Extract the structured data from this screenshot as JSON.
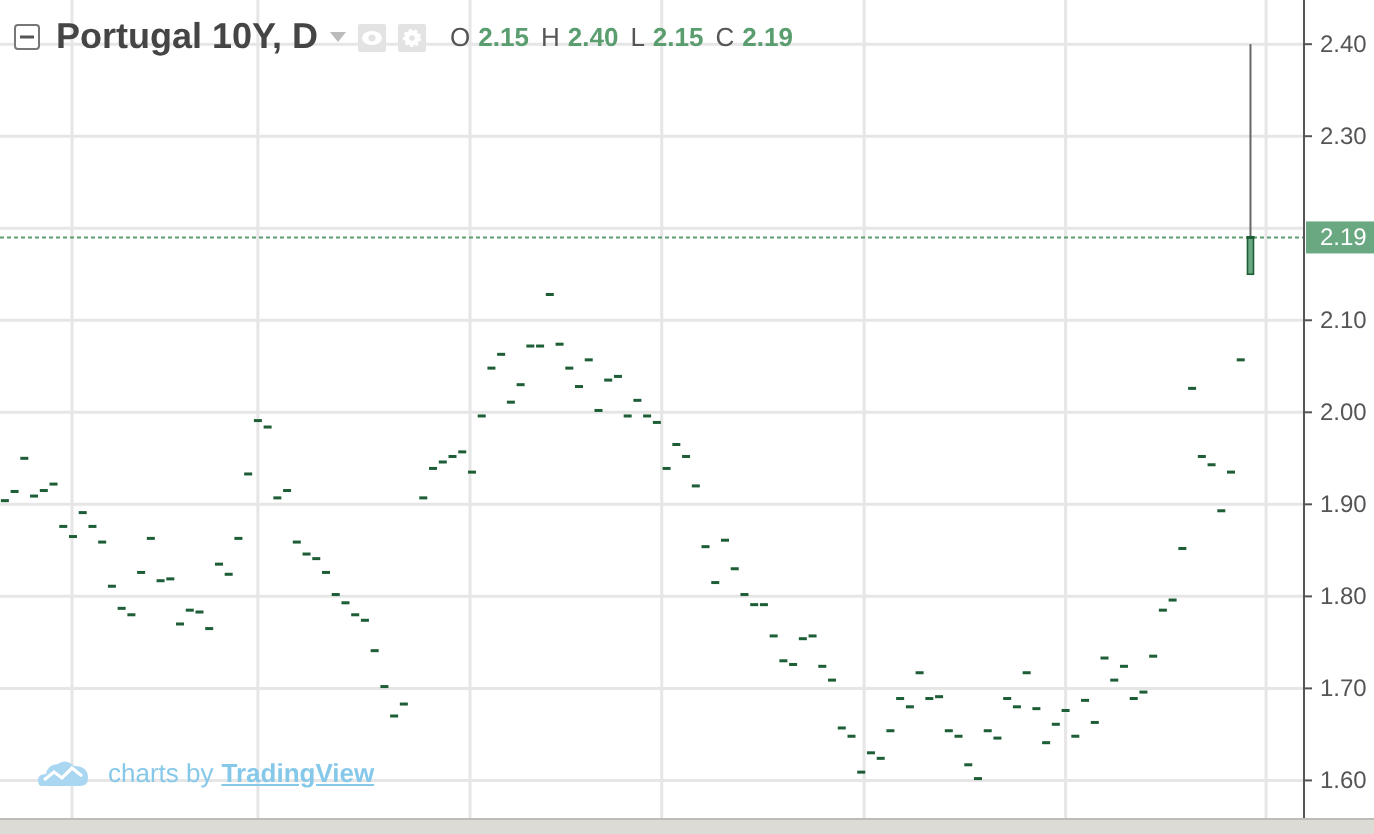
{
  "header": {
    "title": "Portugal 10Y, D",
    "ohlc": [
      {
        "label": "O",
        "value": "2.15"
      },
      {
        "label": "H",
        "value": "2.40"
      },
      {
        "label": "L",
        "value": "2.15"
      },
      {
        "label": "C",
        "value": "2.19"
      }
    ]
  },
  "chart": {
    "chart_data": {
      "type": "scatter",
      "grid": true,
      "ylim": [
        1.557,
        2.448
      ],
      "yticks": [
        {
          "value": 1.6,
          "label": "1.60"
        },
        {
          "value": 1.7,
          "label": "1.70"
        },
        {
          "value": 1.8,
          "label": "1.80"
        },
        {
          "value": 1.9,
          "label": "1.90"
        },
        {
          "value": 2.0,
          "label": "2.00"
        },
        {
          "value": 2.1,
          "label": "2.10"
        },
        {
          "value": 2.3,
          "label": "2.30"
        },
        {
          "value": 2.4,
          "label": "2.40"
        }
      ],
      "ref_lines": [
        {
          "axis": "y",
          "value": 2.19,
          "label": "2.19",
          "color": "#5a9e6f"
        }
      ],
      "series": [
        {
          "color": "#1d5e36",
          "values": [
            1.904,
            1.914,
            1.95,
            1.909,
            1.915,
            1.922,
            1.876,
            1.865,
            1.891,
            1.876,
            1.859,
            1.811,
            1.787,
            1.78,
            1.826,
            1.863,
            1.817,
            1.819,
            1.77,
            1.785,
            1.783,
            1.765,
            1.835,
            1.824,
            1.863,
            1.933,
            1.991,
            1.984,
            1.907,
            1.915,
            1.859,
            1.846,
            1.841,
            1.826,
            1.802,
            1.793,
            1.78,
            1.774,
            1.741,
            1.702,
            1.67,
            1.683,
            null,
            1.907,
            1.939,
            1.946,
            1.952,
            1.957,
            1.935,
            1.996,
            2.048,
            2.063,
            2.011,
            2.03,
            2.072,
            2.072,
            2.128,
            2.074,
            2.048,
            2.028,
            2.057,
            2.002,
            2.035,
            2.039,
            1.996,
            2.013,
            1.996,
            1.989,
            1.939,
            1.965,
            1.952,
            1.92,
            1.854,
            1.815,
            1.861,
            1.83,
            1.802,
            1.791,
            1.791,
            1.757,
            1.73,
            1.726,
            1.754,
            1.757,
            1.724,
            1.709,
            1.657,
            1.648,
            1.609,
            1.63,
            1.624,
            1.654,
            1.689,
            1.68,
            1.717,
            1.689,
            1.691,
            1.654,
            1.648,
            1.617,
            1.602,
            1.654,
            1.646,
            1.689,
            1.68,
            1.717,
            1.678,
            1.641,
            1.661,
            1.676,
            1.648,
            1.687,
            1.663,
            1.733,
            1.709,
            1.724,
            1.689,
            1.696,
            1.735,
            1.785,
            1.796,
            1.852,
            2.026,
            1.952,
            1.943,
            1.893,
            1.935,
            2.057,
            2.19,
            null,
            null,
            null,
            null,
            null
          ]
        }
      ]
    }
  },
  "branding": {
    "prefix": "charts by",
    "link": "TradingView"
  }
}
